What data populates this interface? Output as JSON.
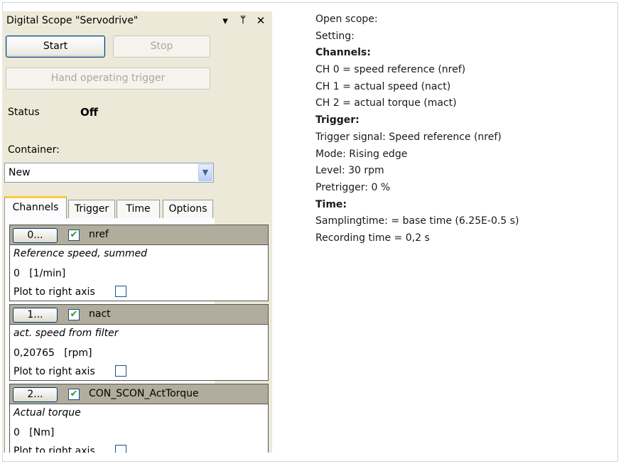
{
  "panel": {
    "title": "Digital Scope \"Servodrive\"",
    "icons": {
      "dropdown": "▾",
      "pin": "ᛘ",
      "close": "✕"
    },
    "buttons": {
      "start": "Start",
      "stop": "Stop",
      "hand_trigger": "Hand operating trigger"
    },
    "status_label": "Status",
    "status_value": "Off",
    "container_label": "Container:",
    "container_value": "New",
    "tabs": [
      "Channels",
      "Trigger",
      "Time",
      "Options"
    ],
    "channels": [
      {
        "button": "0...",
        "checked": "✔",
        "name": "nref",
        "description": "Reference speed, summed",
        "value": "0   [1/min]",
        "plot_label": "Plot to right axis"
      },
      {
        "button": "1...",
        "checked": "✔",
        "name": "nact",
        "description": "act. speed from filter",
        "value": "0,20765   [rpm]",
        "plot_label": "Plot to right axis"
      },
      {
        "button": "2...",
        "checked": "✔",
        "name": "CON_SCON_ActTorque",
        "description": "Actual torque",
        "value": "0   [Nm]",
        "plot_label": "Plot to right axis"
      }
    ]
  },
  "info": {
    "lines": [
      {
        "text": "Open scope:",
        "bold": false
      },
      {
        "text": "Setting:",
        "bold": false
      },
      {
        "text": "Channels:",
        "bold": true
      },
      {
        "text": "CH 0 = speed reference (nref)",
        "bold": false
      },
      {
        "text": "CH 1 = actual speed (nact)",
        "bold": false
      },
      {
        "text": "CH 2 = actual torque (mact)",
        "bold": false
      },
      {
        "text": "Trigger:",
        "bold": true
      },
      {
        "text": "Trigger signal: Speed reference (nref)",
        "bold": false
      },
      {
        "text": "Mode: Rising edge",
        "bold": false
      },
      {
        "text": "Level: 30 rpm",
        "bold": false
      },
      {
        "text": "Pretrigger: 0 %",
        "bold": false
      },
      {
        "text": "Time:",
        "bold": true
      },
      {
        "text": "Samplingtime: = base time (6.25E-0.5 s)",
        "bold": false
      },
      {
        "text": "Recording time = 0,2 s",
        "bold": false
      }
    ]
  }
}
